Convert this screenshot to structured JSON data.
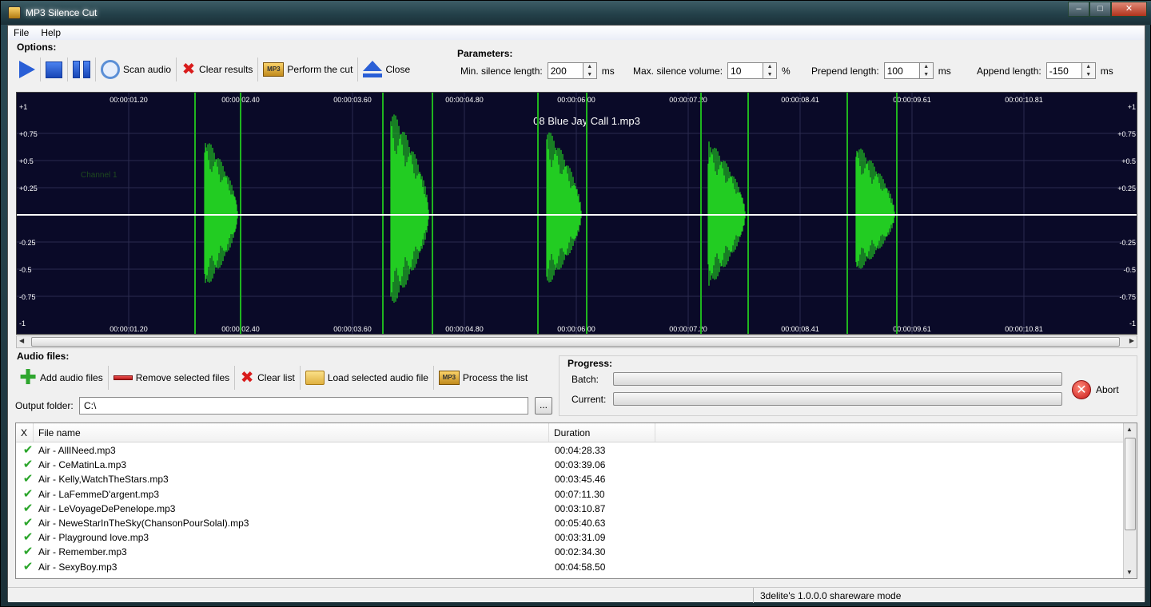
{
  "window": {
    "title": "MP3 Silence Cut",
    "controls": [
      "–",
      "□",
      "✕"
    ]
  },
  "menu": [
    "File",
    "Help"
  ],
  "options": {
    "label": "Options:",
    "scan": "Scan audio",
    "clear_results": "Clear results",
    "perform_cut": "Perform the cut",
    "close": "Close"
  },
  "parameters": {
    "label": "Parameters:",
    "min_silence": {
      "label": "Min. silence length:",
      "value": "200",
      "unit": "ms"
    },
    "max_volume": {
      "label": "Max. silence volume:",
      "value": "10",
      "unit": "%"
    },
    "prepend": {
      "label": "Prepend length:",
      "value": "100",
      "unit": "ms"
    },
    "append": {
      "label": "Append length:",
      "value": "-150",
      "unit": "ms"
    }
  },
  "waveform": {
    "file_label": "08 Blue Jay Call 1.mp3",
    "channel_label": "Channel 1",
    "time_labels": [
      "00:00:01.20",
      "00:00:02.40",
      "00:00:03.60",
      "00:00:04.80",
      "00:00:06.00",
      "00:00:07.20",
      "00:00:08.41",
      "00:00:09.61",
      "00:00:10.81"
    ],
    "amp_labels": [
      "+1",
      "+0.75",
      "+0.5",
      "+0.25",
      "-0.25",
      "-0.5",
      "-0.75",
      "-1"
    ],
    "colors": {
      "background": "#0a0a28",
      "wave": "#22cc22",
      "marker": "#1fb51f",
      "center": "#ffffff"
    }
  },
  "audio_files": {
    "label": "Audio files:",
    "add": "Add audio files",
    "remove": "Remove selected files",
    "clear": "Clear list",
    "load": "Load selected audio file",
    "process": "Process the list",
    "output_label": "Output folder:",
    "output_value": "C:\\",
    "browse": "..."
  },
  "progress": {
    "label": "Progress:",
    "batch_label": "Batch:",
    "current_label": "Current:",
    "batch": 0,
    "current": 0,
    "abort": "Abort"
  },
  "filelist": {
    "columns": [
      "X",
      "File name",
      "Duration"
    ],
    "rows": [
      {
        "name": "Air - AllINeed.mp3",
        "duration": "00:04:28.33"
      },
      {
        "name": "Air - CeMatinLa.mp3",
        "duration": "00:03:39.06"
      },
      {
        "name": "Air - Kelly,WatchTheStars.mp3",
        "duration": "00:03:45.46"
      },
      {
        "name": "Air - LaFemmeD'argent.mp3",
        "duration": "00:07:11.30"
      },
      {
        "name": "Air - LeVoyageDePenelope.mp3",
        "duration": "00:03:10.87"
      },
      {
        "name": "Air - NeweStarInTheSky(ChansonPourSolal).mp3",
        "duration": "00:05:40.63"
      },
      {
        "name": "Air - Playground love.mp3",
        "duration": "00:03:31.09"
      },
      {
        "name": "Air - Remember.mp3",
        "duration": "00:02:34.30"
      },
      {
        "name": "Air - SexyBoy.mp3",
        "duration": "00:04:58.50"
      }
    ]
  },
  "status": {
    "text": "3delite's  1.0.0.0 shareware mode"
  }
}
